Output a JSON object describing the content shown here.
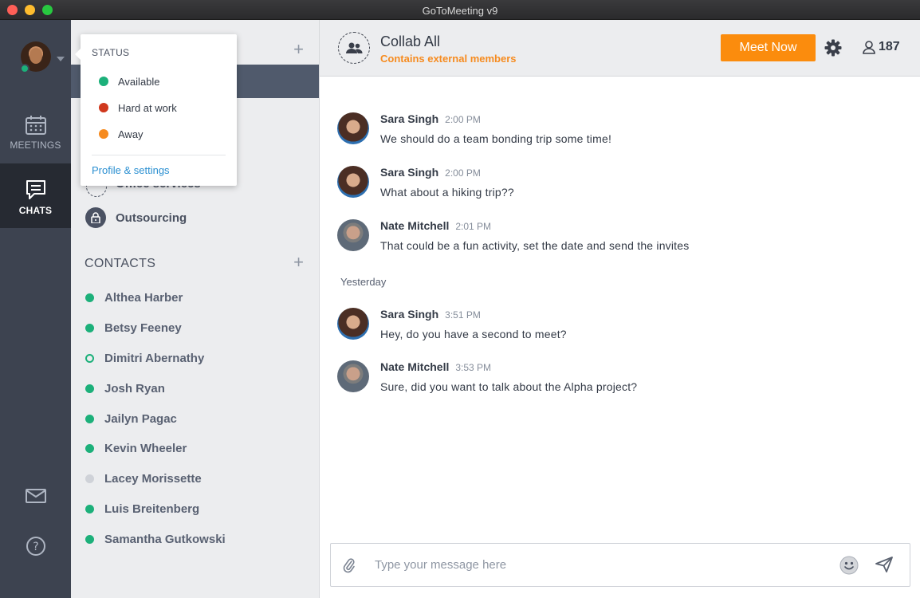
{
  "window": {
    "title": "GoToMeeting v9"
  },
  "rail": {
    "items": [
      {
        "label": "MEETINGS",
        "icon": "calendar-icon"
      },
      {
        "label": "CHATS",
        "icon": "chat-bubble-icon"
      }
    ],
    "bottom_icons": [
      "mail-icon",
      "help-icon"
    ]
  },
  "status_menu": {
    "title": "STATUS",
    "options": [
      {
        "label": "Available",
        "color": "#1cb07a"
      },
      {
        "label": "Hard at work",
        "color": "#d0381d"
      },
      {
        "label": "Away",
        "color": "#f68b1f"
      }
    ],
    "link": "Profile & settings"
  },
  "groups": {
    "add_label": "+",
    "items": [
      {
        "name": "Office services"
      },
      {
        "name": "Outsourcing"
      }
    ]
  },
  "contacts": {
    "title": "CONTACTS",
    "add_label": "+",
    "items": [
      {
        "name": "Althea Harber",
        "status": "online"
      },
      {
        "name": "Betsy Feeney",
        "status": "online"
      },
      {
        "name": "Dimitri Abernathy",
        "status": "hollow"
      },
      {
        "name": "Josh Ryan",
        "status": "online"
      },
      {
        "name": "Jailyn Pagac",
        "status": "online"
      },
      {
        "name": "Kevin Wheeler",
        "status": "online"
      },
      {
        "name": "Lacey Morissette",
        "status": "offline"
      },
      {
        "name": "Luis Breitenberg",
        "status": "online"
      },
      {
        "name": "Samantha Gutkowski",
        "status": "online"
      }
    ]
  },
  "chat": {
    "title": "Collab All",
    "subtitle": "Contains external members",
    "meet_now_label": "Meet Now",
    "participant_count": "187",
    "messages": [
      {
        "name": "Sara Singh",
        "time": "2:00 PM",
        "text": "We should do a team bonding trip some time!",
        "avatar": "sara"
      },
      {
        "name": "Sara Singh",
        "time": "2:00 PM",
        "text": "What about a hiking trip??",
        "avatar": "sara"
      },
      {
        "name": "Nate Mitchell",
        "time": "2:01 PM",
        "text": "That could be a fun activity, set the date and send the invites",
        "avatar": "nate"
      },
      {
        "name": "Sara Singh",
        "time": "3:51 PM",
        "text": "Hey, do you have a second to meet?",
        "avatar": "sara"
      },
      {
        "name": "Nate Mitchell",
        "time": "3:53 PM",
        "text": "Sure, did you want to talk about the Alpha project?",
        "avatar": "nate"
      }
    ],
    "divider_label": "Yesterday",
    "composer": {
      "placeholder": "Type your message here"
    }
  },
  "colors": {
    "accent": "#fb8c0d",
    "online": "#1cb07a",
    "link": "#2a8fd1"
  }
}
